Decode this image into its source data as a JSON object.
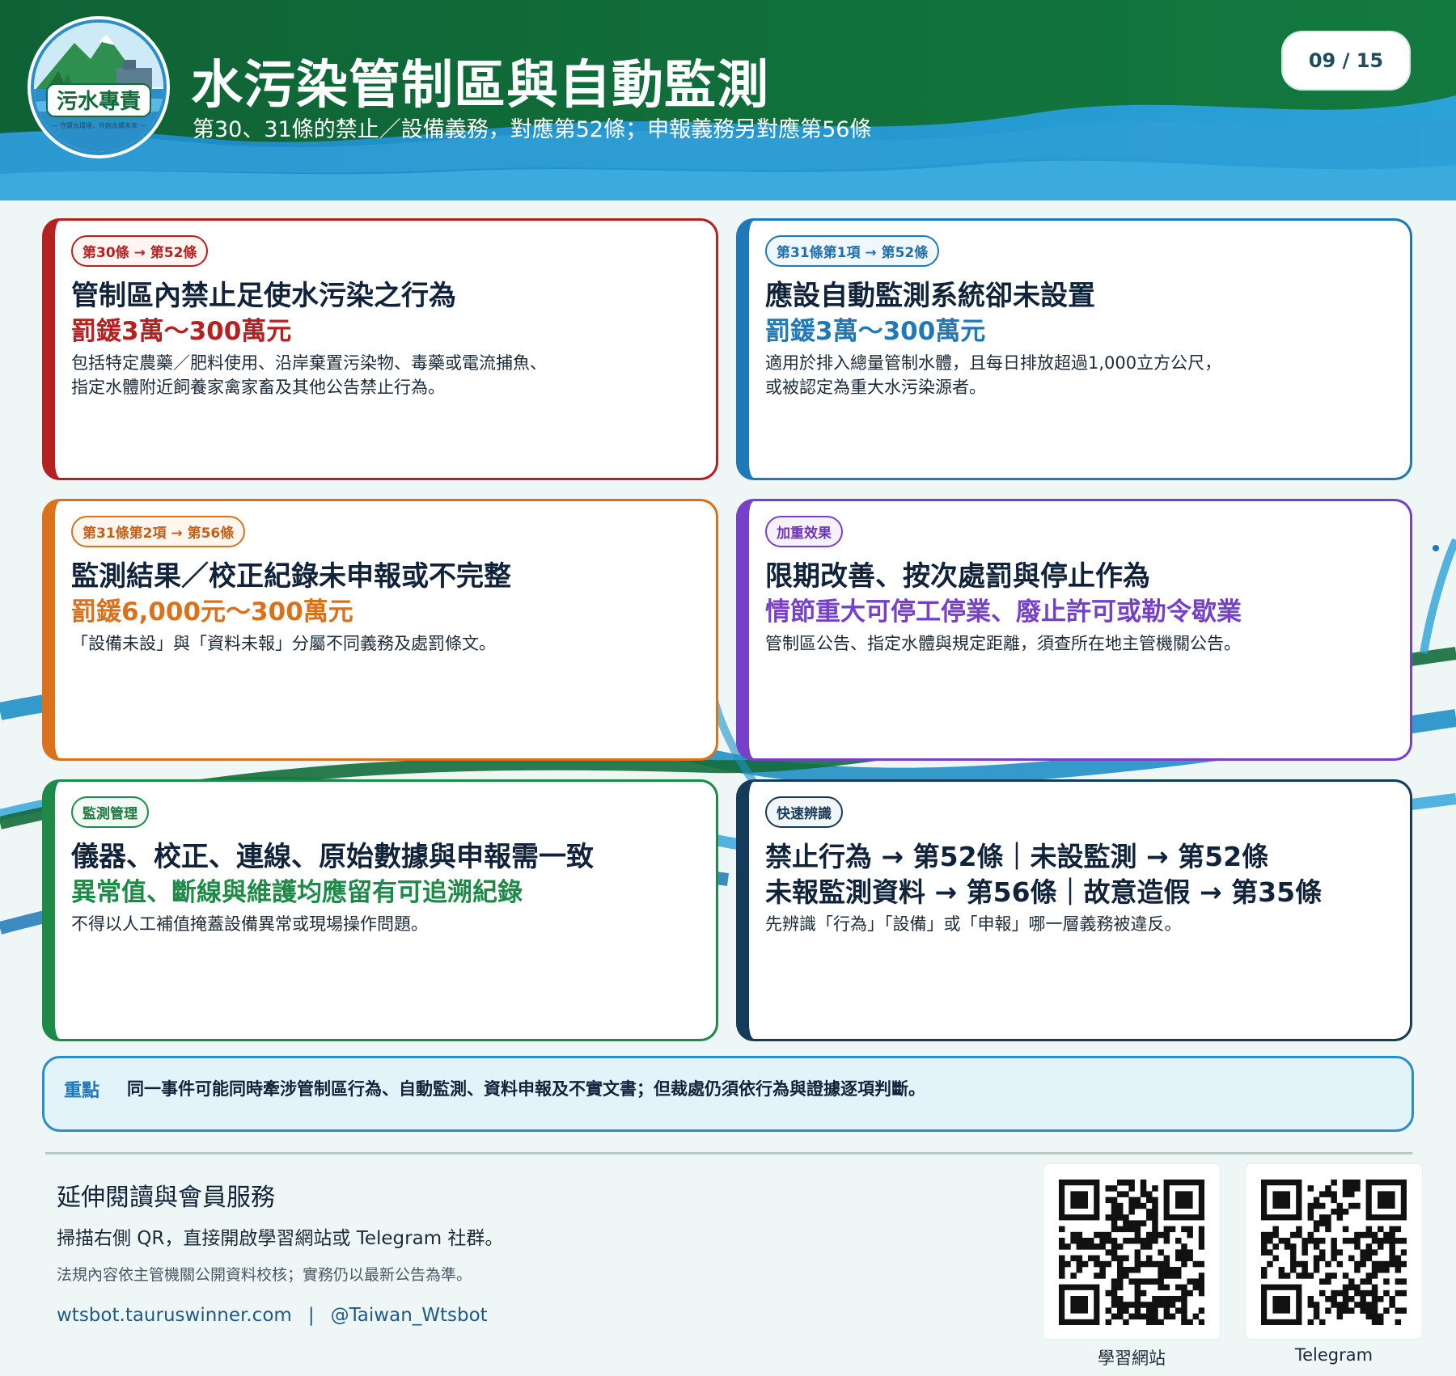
{
  "header": {
    "title": "水污染管制區與自動監測",
    "subtitle": "第30、31條的禁止／設備義務，對應第52條；申報義務另對應第56條",
    "page_indicator": "09 / 15",
    "logo_text": "污水專責",
    "logo_tagline": "— 守護水環境，共創永續未來 —"
  },
  "cards": [
    {
      "tag": "第30條 → 第52條",
      "heading": "管制區內禁止足使水污染之行為",
      "highlight": "罰鍰3萬～300萬元",
      "desc_lines": [
        "包括特定農藥／肥料使用、沿岸棄置污染物、毒藥或電流捕魚、",
        "指定水體附近飼養家禽家畜及其他公告禁止行為。"
      ]
    },
    {
      "tag": "第31條第1項 → 第52條",
      "heading": "應設自動監測系統卻未設置",
      "highlight": "罰鍰3萬～300萬元",
      "desc_lines": [
        "適用於排入總量管制水體，且每日排放超過1,000立方公尺，",
        "或被認定為重大水污染源者。"
      ]
    },
    {
      "tag": "第31條第2項 → 第56條",
      "heading": "監測結果／校正紀錄未申報或不完整",
      "highlight": "罰鍰6,000元～300萬元",
      "desc_lines": [
        "「設備未設」與「資料未報」分屬不同義務及處罰條文。"
      ]
    },
    {
      "tag": "加重效果",
      "heading": "限期改善、按次處罰與停止作為",
      "highlight": "情節重大可停工停業、廢止許可或勒令歇業",
      "desc_lines": [
        "管制區公告、指定水體與規定距離，須查所在地主管機關公告。"
      ]
    },
    {
      "tag": "監測管理",
      "heading": "儀器、校正、連線、原始數據與申報需一致",
      "highlight": "異常值、斷線與維護均應留有可追溯紀錄",
      "desc_lines": [
        "不得以人工補值掩蓋設備異常或現場操作問題。"
      ]
    },
    {
      "tag": "快速辨識",
      "heading_lines": [
        "禁止行為 → 第52條｜未設監測 → 第52條",
        "未報監測資料 → 第56條｜故意造假 → 第35條"
      ],
      "desc_lines": [
        "先辨識「行為」「設備」或「申報」哪一層義務被違反。"
      ]
    }
  ],
  "keypoint": {
    "label": "重點",
    "text": "同一事件可能同時牽涉管制區行為、自動監測、資料申報及不實文書；但裁處仍須依行為與證據逐項判斷。"
  },
  "footer": {
    "title": "延伸閱讀與會員服務",
    "desc": "掃描右側 QR，直接開啟學習網站或 Telegram 社群。",
    "note": "法規內容依主管機關公開資料校核；實務仍以最新公告為準。",
    "link_site": "wtsbot.tauruswinner.com",
    "link_sep": "|",
    "link_telegram": "@Taiwan_Wtsbot",
    "qr_site_label": "學習網站",
    "qr_telegram_label": "Telegram"
  },
  "colors": {
    "header_green": "#136b3a",
    "header_blue": "#1f8fc8",
    "red": "#b52121",
    "blue": "#1f78b8",
    "orange": "#d9711d",
    "purple": "#7640c8",
    "green": "#1e8a47",
    "navy": "#163a5a"
  }
}
